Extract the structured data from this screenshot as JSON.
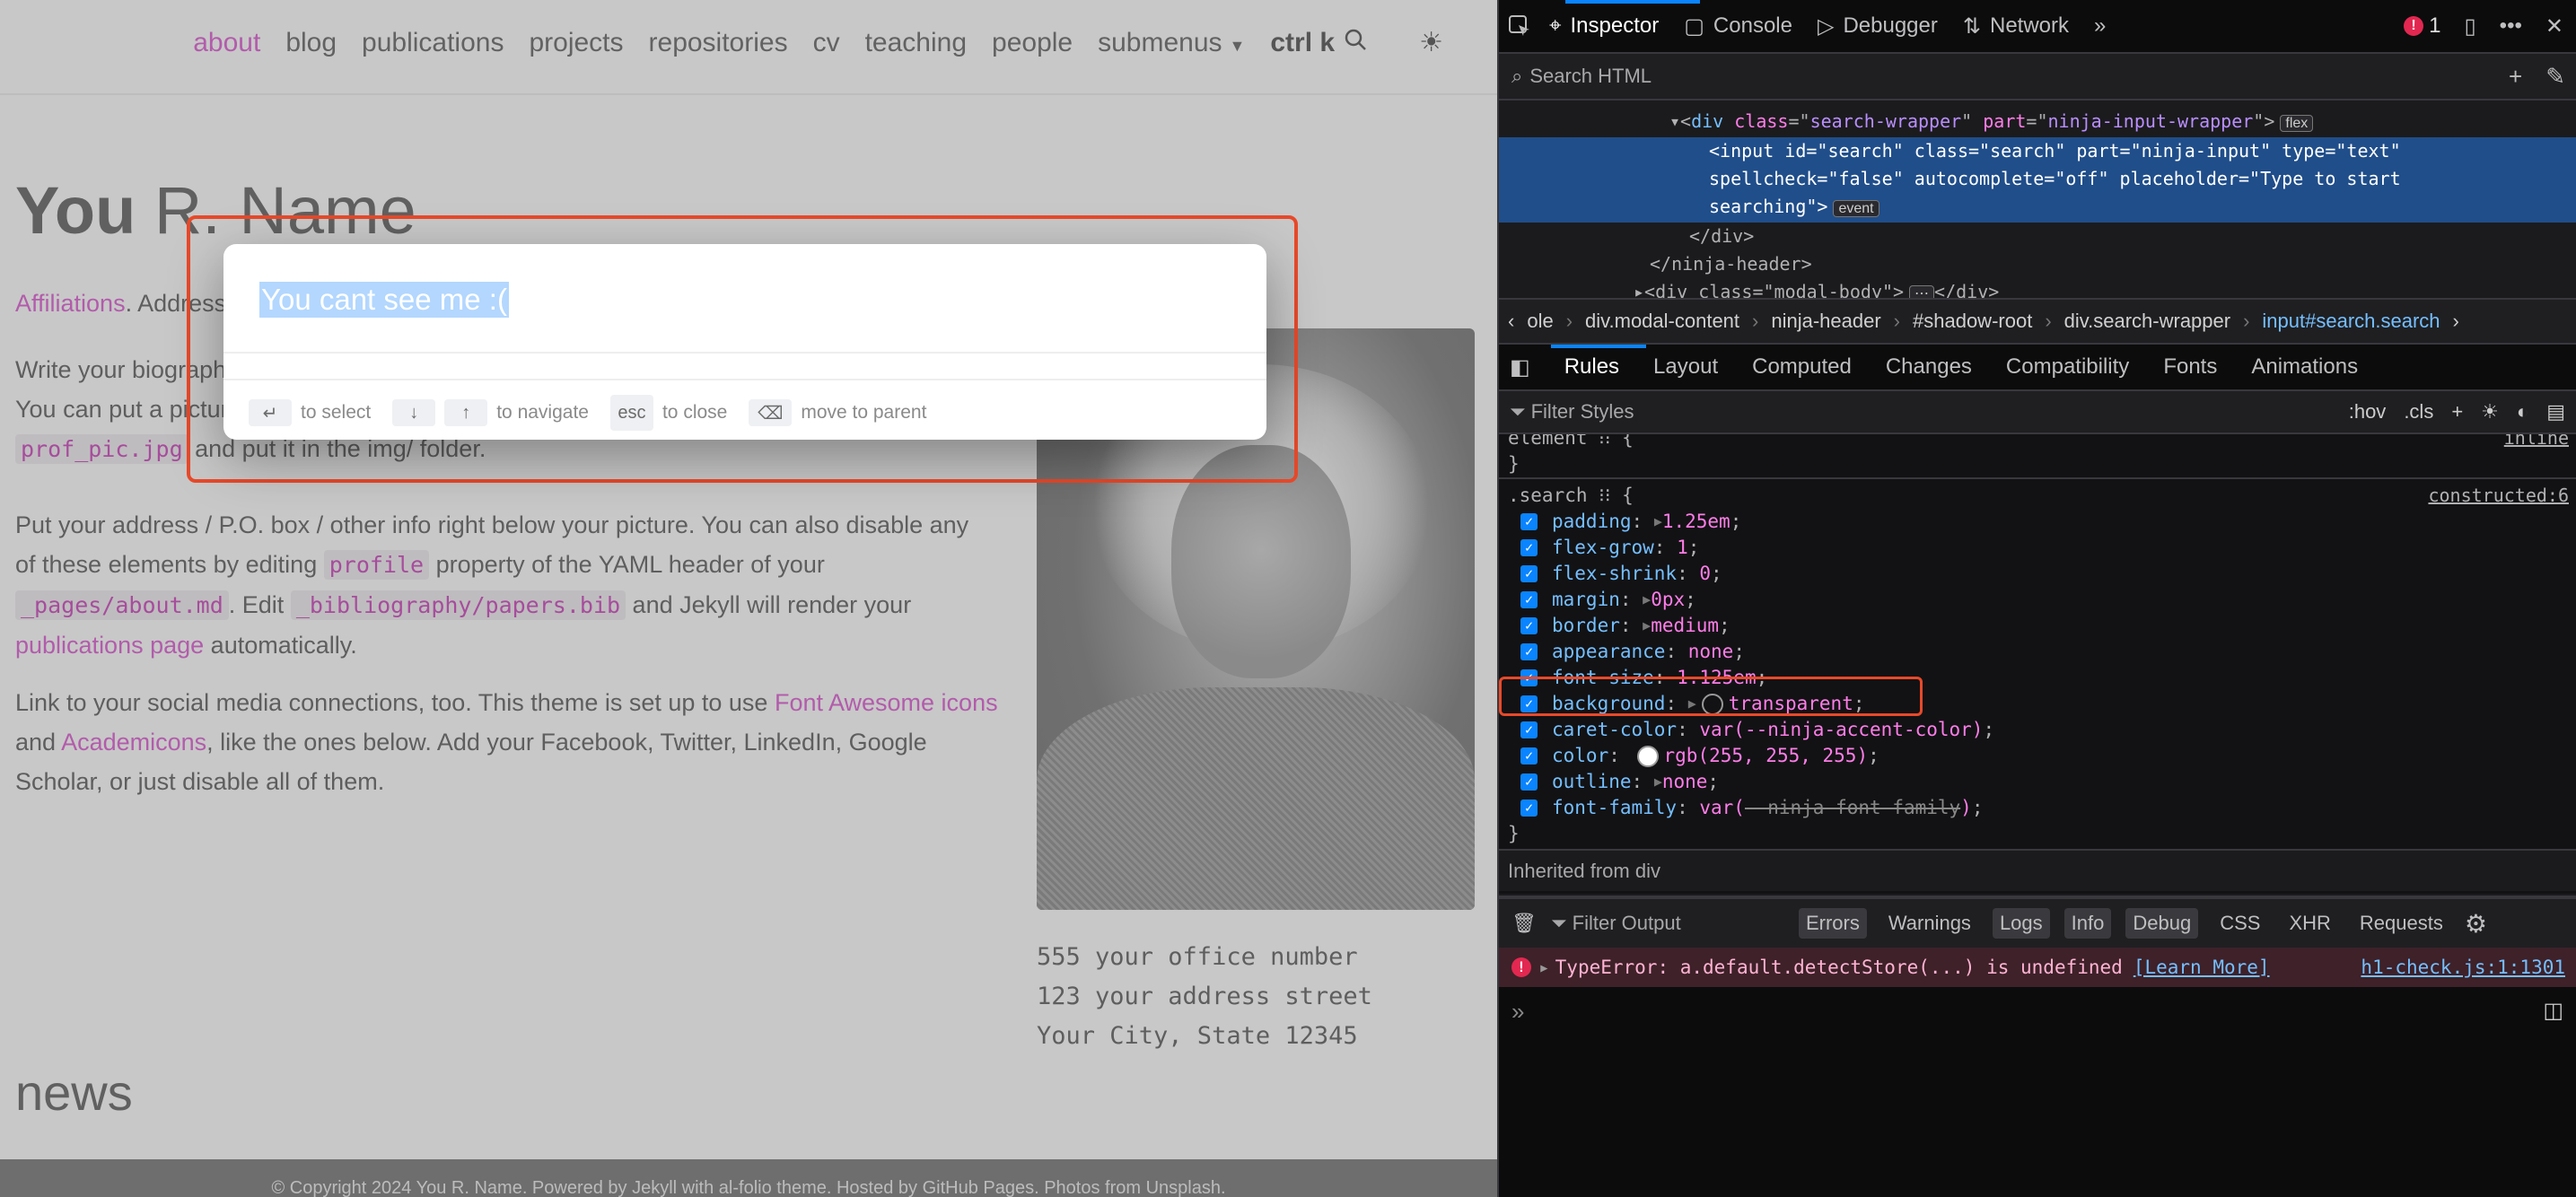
{
  "site": {
    "nav": {
      "items": [
        "about",
        "blog",
        "publications",
        "projects",
        "repositories",
        "cv",
        "teaching",
        "people",
        "submenus"
      ],
      "active": "about",
      "search_shortcut": "ctrl k",
      "accent_color": "#b25cab"
    },
    "title_bold": "You",
    "title_rest": " R. Name",
    "intro": {
      "link": "Affiliations",
      "text": ". Address. Contacts. Motto. Etc."
    },
    "bio": {
      "line1": "Write your biography here. Tell the world about yourself.",
      "line2": "You can put a picture in, too. The code is already in, just name your picture",
      "code": "prof_pic.jpg",
      "line3": " and put it in the img/ folder."
    },
    "para2": {
      "t1": "Put your address / P.O. box / other info right below your picture. You can also disable any of these elements by editing ",
      "code1": "profile",
      "t2": " property of the YAML header of your ",
      "code2": "_pages/about.md",
      "t3": ". Edit ",
      "code3": "_bibliography/papers.bib",
      "t4": " and Jekyll will render your ",
      "link": "publications page",
      "t5": " automatically."
    },
    "para3": {
      "t1": "Link to your social media connections, too. This theme is set up to use ",
      "link1": "Font Awesome icons",
      "t2": " and ",
      "link2": "Academicons",
      "t3": ", like the ones below. Add your Facebook, Twitter, LinkedIn, Google Scholar, or just disable all of them."
    },
    "address": "555 your office number\n123 your address street\nYour City, State 12345",
    "news_heading": "news",
    "footer": "© Copyright 2024 You R. Name. Powered by Jekyll with al-folio theme. Hosted by GitHub Pages. Photos from Unsplash."
  },
  "modal": {
    "input_value": "You cant see me :(",
    "input_placeholder": "Type to start searching",
    "hints": [
      {
        "keys": [
          "↵"
        ],
        "label": "to select"
      },
      {
        "keys": [
          "↓",
          "↑"
        ],
        "label": "to navigate"
      },
      {
        "keys": [
          "esc"
        ],
        "label": "to close"
      },
      {
        "keys": [
          "⌫"
        ],
        "label": "move to parent"
      }
    ],
    "highlight_color": "#e8492a",
    "selection_color": "#b3d7fe"
  },
  "devtools": {
    "tabs": [
      "Inspector",
      "Console",
      "Debugger",
      "Network"
    ],
    "active_tab": "Inspector",
    "error_count": "1",
    "search_placeholder": "Search HTML",
    "markup": {
      "line1_tag": "div",
      "line1_class": "search-wrapper",
      "line1_part": "ninja-input-wrapper",
      "line1_badge": "flex",
      "input_line": "<input id=\"search\" class=\"search\" part=\"ninja-input\" type=\"text\"",
      "input_line2": "spellcheck=\"false\" autocomplete=\"off\" placeholder=\"Type to start",
      "input_line3": "searching\">",
      "input_badge": "event",
      "close_div": "</div>",
      "close_header": "</ninja-header>",
      "modal_body": "<div class=\"modal-body\">",
      "modal_body_close": "</div>"
    },
    "breadcrumb": [
      "ole",
      "div.modal-content",
      "ninja-header",
      "#shadow-root",
      "div.search-wrapper",
      "input#search.search"
    ],
    "sub_tabs": [
      "Rules",
      "Layout",
      "Computed",
      "Changes",
      "Compatibility",
      "Fonts",
      "Animations"
    ],
    "active_sub_tab": "Rules",
    "filter_styles_placeholder": "Filter Styles",
    "filter_tools": [
      ":hov",
      ".cls"
    ],
    "element_rule": {
      "selector": "element",
      "source": "inline"
    },
    "search_rule": {
      "selector": ".search",
      "source": "constructed:6",
      "declarations": [
        {
          "prop": "padding",
          "value": "1.25em",
          "expand": true
        },
        {
          "prop": "flex-grow",
          "value": "1"
        },
        {
          "prop": "flex-shrink",
          "value": "0"
        },
        {
          "prop": "margin",
          "value": "0px",
          "expand": true
        },
        {
          "prop": "border",
          "value": "medium",
          "expand": true
        },
        {
          "prop": "appearance",
          "value": "none"
        },
        {
          "prop": "font-size",
          "value": "1.125em"
        },
        {
          "prop": "background",
          "value": "transparent",
          "expand": true,
          "swatch": "transparent"
        },
        {
          "prop": "caret-color",
          "value": "var(--ninja-accent-color)"
        },
        {
          "prop": "color",
          "value": "rgb(255, 255, 255)",
          "swatch": "white",
          "highlighted": true
        },
        {
          "prop": "outline",
          "value": "none",
          "expand": true
        },
        {
          "prop": "font-family",
          "value": "var(--ninja-font-family)",
          "strike_var": true
        }
      ]
    },
    "inherited_label": "Inherited from div",
    "console": {
      "filter_placeholder": "Filter Output",
      "filters": [
        {
          "label": "Errors",
          "on": true
        },
        {
          "label": "Warnings",
          "on": false
        },
        {
          "label": "Logs",
          "on": true
        },
        {
          "label": "Info",
          "on": true
        },
        {
          "label": "Debug",
          "on": true
        }
      ],
      "types": [
        "CSS",
        "XHR",
        "Requests"
      ],
      "error_message": "TypeError: a.default.detectStore(...) is undefined",
      "learn_more": "[Learn More]",
      "error_location": "h1-check.js:1:1301"
    }
  }
}
